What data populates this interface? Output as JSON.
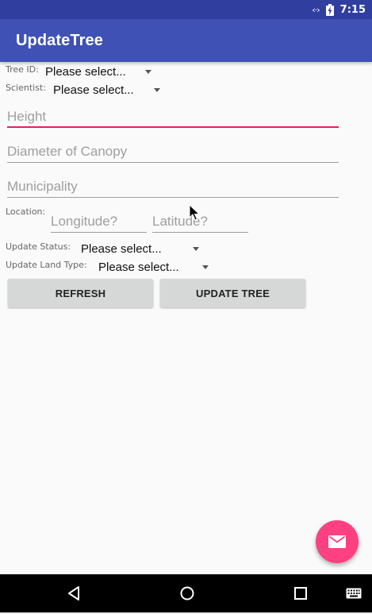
{
  "status_bar": {
    "data_icon": "‹·›",
    "time": "7:15"
  },
  "app_bar": {
    "title": "UpdateTree"
  },
  "form": {
    "tree_id": {
      "label": "Tree ID:",
      "value": "Please select..."
    },
    "scientist": {
      "label": "Scientist:",
      "value": "Please select..."
    },
    "height": {
      "placeholder": "Height",
      "value": ""
    },
    "diameter": {
      "placeholder": "Diameter of Canopy",
      "value": ""
    },
    "municipality": {
      "placeholder": "Municipality",
      "value": ""
    },
    "location": {
      "label": "Location:",
      "longitude_placeholder": "Longitude?",
      "latitude_placeholder": "Latitude?"
    },
    "update_status": {
      "label": "Update Status:",
      "value": "Please select..."
    },
    "update_land_type": {
      "label": "Update Land Type:",
      "value": "Please select..."
    }
  },
  "buttons": {
    "refresh": "REFRESH",
    "update_tree": "UPDATE TREE"
  },
  "icons": {
    "fab": "mail-icon",
    "nav_back": "back-triangle-icon",
    "nav_home": "home-circle-icon",
    "nav_recents": "recents-square-icon",
    "nav_keyboard": "keyboard-icon"
  },
  "colors": {
    "primary": "#3f51b5",
    "primary_dark": "#303f9f",
    "accent": "#ff4081",
    "focus_underline": "#e91e63"
  }
}
